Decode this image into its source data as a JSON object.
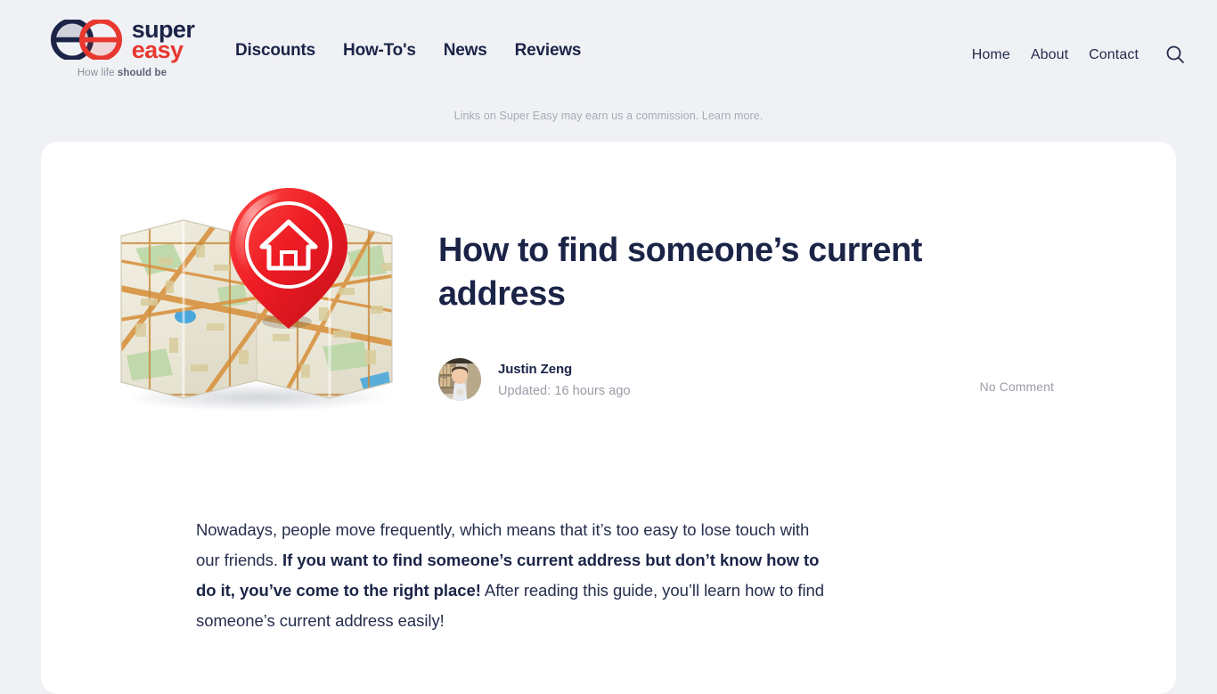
{
  "site": {
    "brand_super": "super",
    "brand_easy": "easy",
    "tagline_light": "How life ",
    "tagline_bold": "should be",
    "logo_icon": "double-e-logo",
    "colors": {
      "navy": "#1b2447",
      "red": "#e8382f",
      "page_bg": "#f0f1f5",
      "card_bg": "#ffffff",
      "muted": "#9a9da8"
    }
  },
  "nav": {
    "primary": [
      {
        "label": "Discounts"
      },
      {
        "label": "How-To's"
      },
      {
        "label": "News"
      },
      {
        "label": "Reviews"
      }
    ],
    "secondary": [
      {
        "label": "Home"
      },
      {
        "label": "About"
      },
      {
        "label": "Contact"
      }
    ],
    "search_icon": "search-icon"
  },
  "disclaimer": {
    "text": "Links on Super Easy may earn us a commission.",
    "link_label": "Learn more."
  },
  "article": {
    "hero_image": "folded-map-with-home-location-pin",
    "title": "How to find someone’s current address",
    "author": {
      "name": "Justin Zeng",
      "avatar": "author-avatar-photo"
    },
    "updated": "Updated: 16 hours ago",
    "comments": "No Comment",
    "body": {
      "p1_part1": "Nowadays, people move frequently, which means that it’s too easy to lose touch with our friends. ",
      "p1_bold": "If you want to find someone’s current address but don’t know how to do it, you’ve come to the right place!",
      "p1_part2": " After reading this guide, you’ll learn how to find someone’s current address easily!"
    }
  }
}
